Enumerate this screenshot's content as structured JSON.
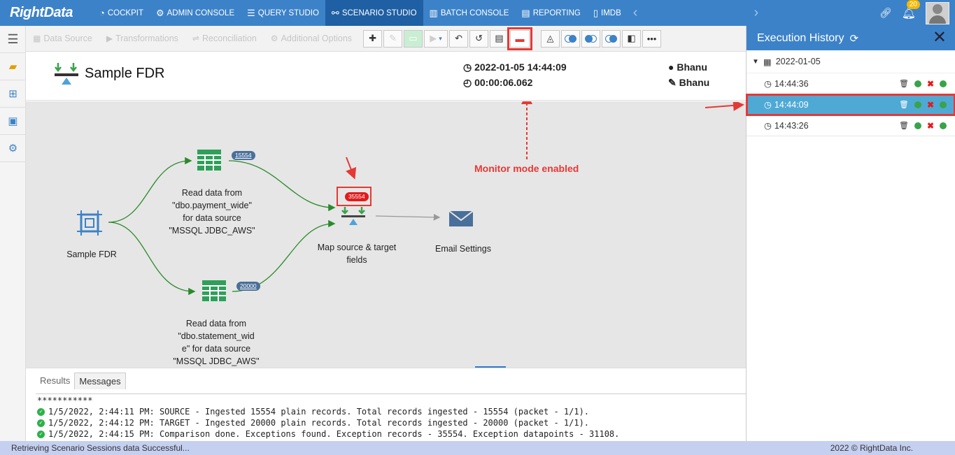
{
  "brand": {
    "logo_text": "RightData"
  },
  "nav": {
    "items": [
      {
        "label": "COCKPIT",
        "icon": "cockpit-icon"
      },
      {
        "label": "ADMIN CONSOLE",
        "icon": "gear-icon"
      },
      {
        "label": "QUERY STUDIO",
        "icon": "database-icon"
      },
      {
        "label": "SCENARIO STUDIO",
        "icon": "scenario-icon",
        "active": true
      },
      {
        "label": "BATCH CONSOLE",
        "icon": "batch-icon"
      },
      {
        "label": "REPORTING",
        "icon": "report-icon"
      },
      {
        "label": "IMDB",
        "icon": "imdb-icon"
      }
    ],
    "notification_count": "20"
  },
  "toolbar": {
    "tabs": [
      "Data Source",
      "Transformations",
      "Reconciliation",
      "Additional Options"
    ]
  },
  "scenario": {
    "title": "Sample FDR",
    "run_datetime": "2022-01-05 14:44:09",
    "run_duration": "00:00:06.062",
    "created_by": "Bhanu",
    "modified_by": "Bhanu"
  },
  "canvas": {
    "nodes": {
      "source": {
        "label": "Sample FDR"
      },
      "read1": {
        "label_lines": [
          "Read data from",
          "\"dbo.payment_wide\"",
          "for data source",
          "\"MSSQL JDBC_AWS\""
        ],
        "count": "15554"
      },
      "read2": {
        "label_lines": [
          "Read data from",
          "\"dbo.statement_wid",
          "e\" for data source",
          "\"MSSQL JDBC_AWS\""
        ],
        "count": "20000"
      },
      "map": {
        "label_lines": [
          "Map source & target",
          "fields"
        ],
        "count": "35554"
      },
      "email": {
        "label": "Email Settings"
      }
    },
    "annotation": "Monitor mode enabled"
  },
  "bottom": {
    "tabs": [
      "Results",
      "Messages"
    ],
    "active_tab": "Messages",
    "log": [
      {
        "text": "***********",
        "ok": false
      },
      {
        "text": "1/5/2022, 2:44:11 PM: SOURCE - Ingested 15554 plain records. Total records ingested - 15554 (packet - 1/1).",
        "ok": true
      },
      {
        "text": "1/5/2022, 2:44:12 PM: TARGET - Ingested 20000 plain records. Total records ingested - 20000 (packet - 1/1).",
        "ok": true
      },
      {
        "text": "1/5/2022, 2:44:15 PM: Comparison done. Exceptions found. Exception records - 35554. Exception datapoints - 31108.",
        "ok": true
      }
    ]
  },
  "history": {
    "title": "Execution History",
    "date": "2022-01-05",
    "runs": [
      {
        "time": "14:44:36",
        "selected": false
      },
      {
        "time": "14:44:09",
        "selected": true
      },
      {
        "time": "14:43:26",
        "selected": false
      }
    ]
  },
  "status": {
    "message": "Retrieving Scenario Sessions data Successful...",
    "copyright": "2022 © RightData Inc."
  }
}
